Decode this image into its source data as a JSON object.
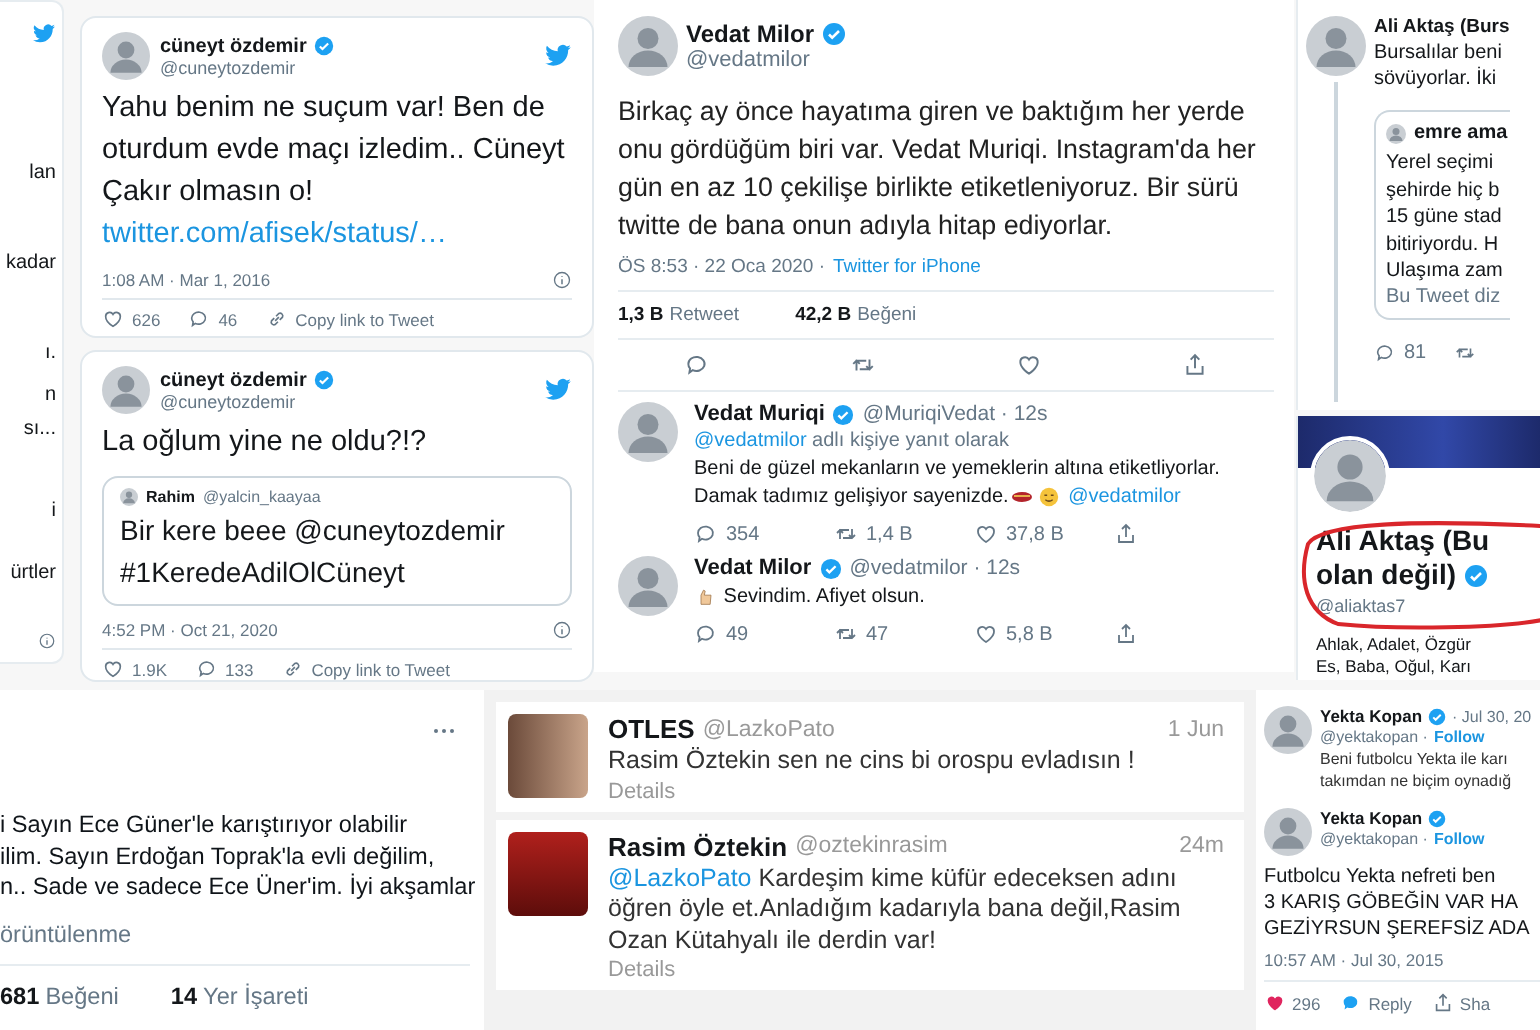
{
  "left_fragment": {
    "lines": [
      "lan",
      "kadar",
      "ı.",
      "n",
      "sı...",
      "i",
      "ürtler"
    ]
  },
  "cuneyt_tweets": [
    {
      "name": "cüneyt özdemir",
      "verified": true,
      "handle": "@cuneytozdemir",
      "text": "Yahu benim ne suçum var! Ben de oturdum evde maçı izledim.. Cüneyt Çakır olmasın o!",
      "link": "twitter.com/afisek/status/…",
      "time": "1:08 AM · Mar 1, 2016",
      "likes": "626",
      "replies": "46",
      "copy": "Copy link to Tweet"
    },
    {
      "name": "cüneyt özdemir",
      "verified": true,
      "handle": "@cuneytozdemir",
      "text": "La oğlum yine ne oldu?!?",
      "quote": {
        "name": "Rahim",
        "handle": "@yalcin_kaayaa",
        "text": "Bir kere beee @cuneytozdemir #1KeredeAdilOlCüneyt"
      },
      "time": "4:52 PM · Oct 21, 2020",
      "likes": "1.9K",
      "replies": "133",
      "copy": "Copy link to Tweet"
    }
  ],
  "vedat_thread": {
    "name": "Vedat Milor",
    "verified": true,
    "handle": "@vedatmilor",
    "text": "Birkaç ay önce hayatıma giren ve baktığım her yerde onu gördüğüm biri var. Vedat Muriqi. Instagram'da her gün en az 10 çekilişe birlikte etiketleniyoruz. Bir sürü twitte de bana onun adıyla hitap ediyorlar.",
    "time": "ÖS 8:53 · 22 Oca 2020 ·",
    "source": "Twitter for iPhone",
    "stats": [
      {
        "value": "1,3 B",
        "label": "Retweet"
      },
      {
        "value": "42,2 B",
        "label": "Beğeni"
      }
    ],
    "replies": [
      {
        "name": "Vedat Muriqi",
        "verified": true,
        "handle": "@MuriqiVedat · 12s",
        "reply_to": "@vedatmilor",
        "reply_context": "adlı kişiye yanıt olarak",
        "text": "Beni de güzel mekanların ve yemeklerin altına etiketliyorlar. Damak tadımız gelişiyor sayenizde.",
        "mention": "@vedatmilor",
        "replies": "354",
        "retweets": "1,4 B",
        "likes": "37,8 B"
      },
      {
        "name": "Vedat Milor",
        "verified": true,
        "handle": "@vedatmilor · 12s",
        "text": "Sevindim. Afiyet olsun.",
        "replies": "49",
        "retweets": "47",
        "likes": "5,8 B"
      }
    ]
  },
  "ali_tweet": {
    "name": "Ali Aktaş (Burs",
    "text_lines": [
      "Bursalılar beni",
      "sövüyorlar. İki"
    ],
    "quote": {
      "name": "emre ama",
      "lines": [
        "Yerel seçimi",
        "şehirde hiç b",
        "15 güne stad",
        "bitiriyordu. H",
        "Ulaşıma zam"
      ],
      "footer": "Bu Tweet diz"
    },
    "replies": "81"
  },
  "ali_profile": {
    "name_lines": [
      "Ali Aktaş (Bu",
      "olan değil)"
    ],
    "verified": true,
    "handle": "@aliaktas7",
    "bio_lines": [
      "Ahlak, Adalet, Özgür",
      "Es, Baba, Oğul, Karı"
    ]
  },
  "ece_tweet": {
    "lines": [
      "i Sayın Ece Güner'le karıştırıyor olabilir",
      "ilim. Sayın Erdoğan Toprak'la evli değilim,",
      "n.. Sade ve sadece Ece Üner'im. İyi akşamlar"
    ],
    "views": "örüntülenme",
    "stats": [
      {
        "value": "681",
        "label": "Beğeni"
      },
      {
        "value": "14",
        "label": "Yer İşareti"
      }
    ]
  },
  "otles_conversation": [
    {
      "name": "OTLES",
      "handle": "@LazkoPato",
      "time": "1 Jun",
      "text": "Rasim Öztekin sen ne cins bi orospu evladısın !",
      "details": "Details"
    },
    {
      "name": "Rasim Öztekin",
      "handle": "@oztekinrasim",
      "time": "24m",
      "mention": "@LazkoPato",
      "text": "Kardeşim kime küfür edeceksen adını öğren öyle et.Anladığım kadarıyla bana değil,Rasim Ozan Kütahyalı ile derdin var!",
      "details": "Details"
    }
  ],
  "yekta_thread": [
    {
      "name": "Yekta Kopan",
      "verified": true,
      "date": "· Jul 30, 20",
      "handle": "@yektakopan ·",
      "follow": "Follow",
      "lines": [
        "Beni futbolcu Yekta ile karı",
        "takımdan ne biçim oynadığ"
      ]
    },
    {
      "name": "Yekta Kopan",
      "verified": true,
      "handle": "@yektakopan ·",
      "follow": "Follow",
      "lines": [
        "Futbolcu Yekta nefreti ben",
        "3 KARIŞ GÖBEĞİN VAR HA",
        "GEZİYRSUN ŞEREFSİZ ADA"
      ],
      "time": "10:57 AM · Jul 30, 2015",
      "likes": "296",
      "liked": true,
      "reply": "Reply",
      "share": "Sha"
    }
  ]
}
